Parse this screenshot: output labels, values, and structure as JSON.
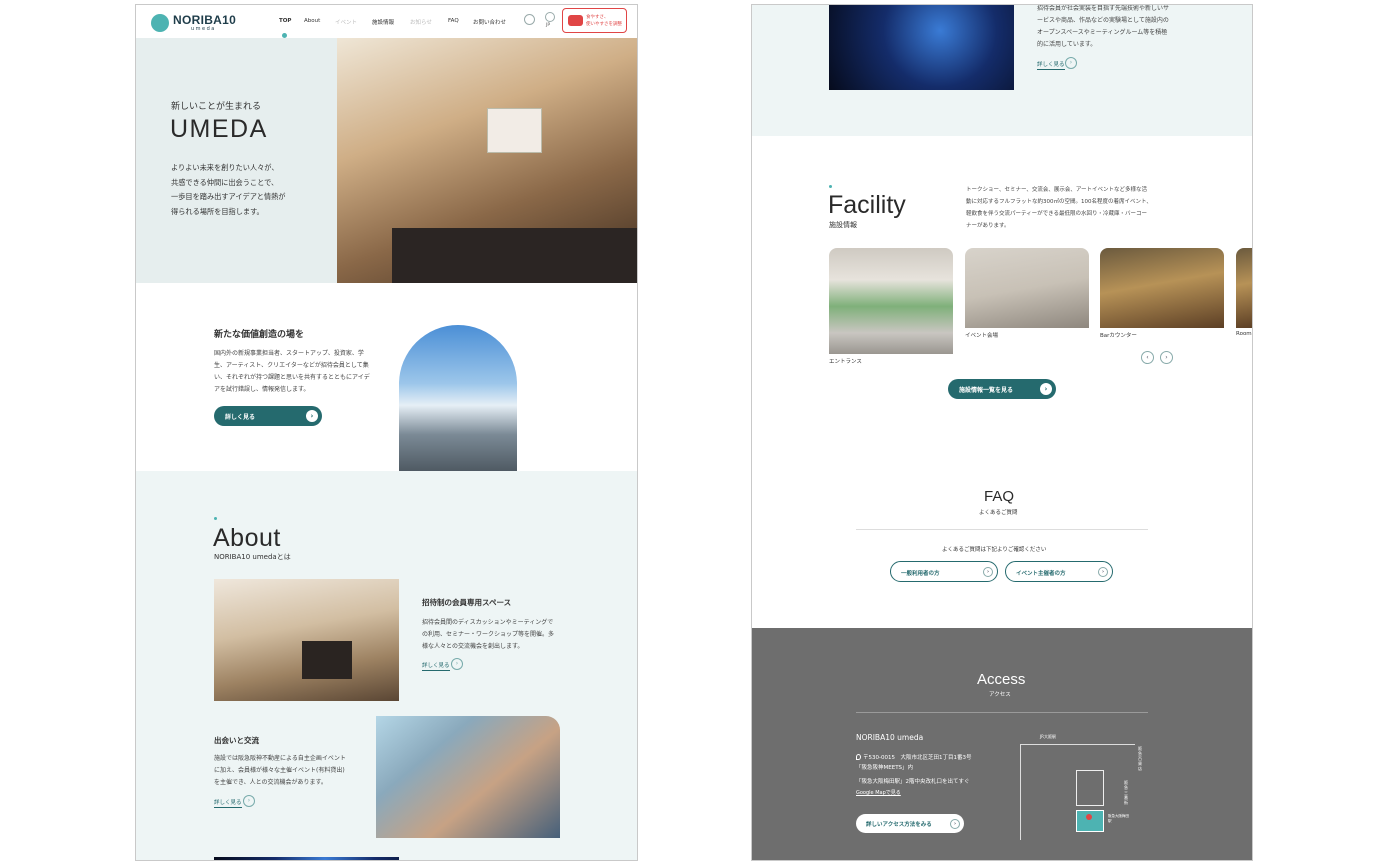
{
  "header": {
    "logo_text": "NORIBA10",
    "logo_sub": "umeda",
    "nav": [
      "TOP",
      "About",
      "イベント",
      "施設情報",
      "お知らせ",
      "FAQ",
      "お問い合わせ"
    ],
    "lang": "JP",
    "cta_line1": "食やすさ、",
    "cta_line2": "使いやすさを調整"
  },
  "hero": {
    "small": "新しいことが生まれる",
    "title": "UMEDA",
    "body": [
      "よりよい未来を創りたい人々が、",
      "共感できる仲間に出会うことで、",
      "一歩目を踏み出すアイデアと情熱が",
      "得られる場所を目指します。"
    ]
  },
  "value": {
    "title": "新たな価値創造の場を",
    "body": [
      "国内外の新規事業担当者、スタートアップ、投資家、学",
      "生、アーティスト、クリエイターなどが招待会員として集",
      "い、それぞれが持つ課題と思いを共有するとともにアイデ",
      "アを試行錯誤し、情報発信します。"
    ],
    "button": "詳しく見る"
  },
  "about": {
    "title": "About",
    "subtitle": "NORIBA10 umedaとは",
    "item1": {
      "title": "招待制の会員専用スペース",
      "body": [
        "招待会員間のディスカッションやミーティングで",
        "の利用、セミナー・ワークショップ等を開催。多",
        "様な人々との交流機会を創出します。"
      ],
      "more": "詳しく見る"
    },
    "item2": {
      "title": "出会いと交流",
      "body": [
        "施設では阪急阪神不動産による自主企画イベント",
        "に加え、会員様が様々な主催イベント(有料貸出)",
        "を主催でき、人との交流機会があります。"
      ],
      "more": "詳しく見る"
    }
  },
  "right_top": {
    "body": [
      "招待会員が社会実装を目指す先端技術や新しいサ",
      "ービスや商品、作品などの実験場として施設内の",
      "オープンスペースやミーティングルーム等を積極",
      "的に活用しています。"
    ],
    "more": "詳しく見る"
  },
  "facility": {
    "title": "Facility",
    "subtitle": "施設情報",
    "body": [
      "トークショー、セミナー、交流会、展示会、アートイベントなど多様な活",
      "動に対応するフルフラットな約300㎡の空間。100名程度の着席イベント、",
      "軽飲食を伴う交流パーティーができる最低限の水回り・冷蔵庫・バーコー",
      "ナーがあります。"
    ],
    "cards": [
      "エントランス",
      "イベント会場",
      "Barカウンター",
      "Room"
    ],
    "button": "施設情報一覧を見る"
  },
  "faq": {
    "title": "FAQ",
    "subtitle": "よくあるご質問",
    "lead": "よくあるご質問は下記よりご確認ください",
    "btn1": "一般利用者の方",
    "btn2": "イベント主催者の方"
  },
  "access": {
    "title": "Access",
    "subtitle": "アクセス",
    "name": "NORIBA10 umeda",
    "addr1": "〒530-0015　大阪市北区芝田1丁目1番3号",
    "addr2": "「阪急阪神MEETS」内",
    "addr3": "「阪急大阪梅田駅」2階中央改札口を出てすぐ",
    "gmap": "Google Mapで見る",
    "button": "詳しいアクセス方法をみる",
    "map_label1": "JR大阪駅",
    "map_label2": "阪急大阪梅田駅",
    "map_label3": "阪急百貨店",
    "map_label4": "阪急三番街"
  }
}
